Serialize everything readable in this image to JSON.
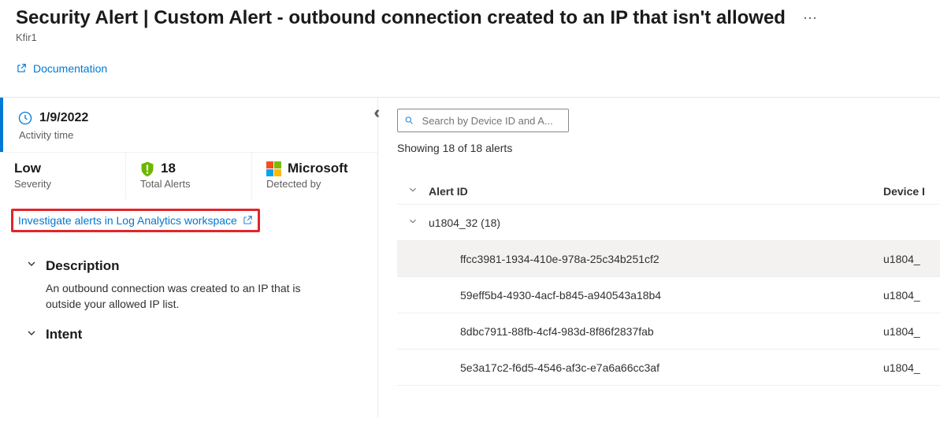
{
  "header": {
    "title": "Security Alert | Custom Alert - outbound connection created to an IP that isn't allowed",
    "subtitle": "Kfir1",
    "documentation_label": "Documentation"
  },
  "summary": {
    "activity_date": "1/9/2022",
    "activity_label": "Activity time",
    "severity_value": "Low",
    "severity_label": "Severity",
    "total_alerts_value": "18",
    "total_alerts_label": "Total Alerts",
    "detected_by_value": "Microsoft",
    "detected_by_label": "Detected by"
  },
  "investigate_link": "Investigate alerts in Log Analytics workspace",
  "sections": {
    "description_title": "Description",
    "description_body": "An outbound connection was created to an IP that is outside your allowed IP list.",
    "intent_title": "Intent"
  },
  "right": {
    "search_placeholder": "Search by Device ID and A...",
    "showing_text": "Showing 18 of 18 alerts",
    "columns": {
      "alert_id": "Alert ID",
      "device": "Device I"
    },
    "group": {
      "label": "u1804_32 (18)"
    },
    "rows": [
      {
        "id": "ffcc3981-1934-410e-978a-25c34b251cf2",
        "device": "u1804_",
        "highlight": true
      },
      {
        "id": "59eff5b4-4930-4acf-b845-a940543a18b4",
        "device": "u1804_",
        "highlight": false
      },
      {
        "id": "8dbc7911-88fb-4cf4-983d-8f86f2837fab",
        "device": "u1804_",
        "highlight": false
      },
      {
        "id": "5e3a17c2-f6d5-4546-af3c-e7a6a66cc3af",
        "device": "u1804_",
        "highlight": false
      }
    ]
  }
}
